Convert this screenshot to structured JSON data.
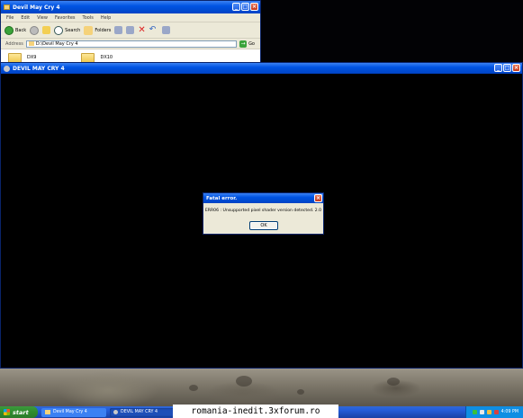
{
  "explorer": {
    "title": "Devil May Cry 4",
    "menu": [
      "File",
      "Edit",
      "View",
      "Favorites",
      "Tools",
      "Help"
    ],
    "toolbar": {
      "back": "Back",
      "search": "Search",
      "folders": "Folders"
    },
    "address_label": "Address",
    "address_value": "D:\\Devil May Cry 4",
    "go_label": "Go",
    "files": [
      {
        "name": "DX9",
        "icon": "folder-icon"
      },
      {
        "name": "DX10",
        "icon": "folder-icon"
      }
    ]
  },
  "game_window": {
    "title": "DEVIL MAY CRY 4"
  },
  "dialog": {
    "title": "Fatal error.",
    "message": "ERR06 : Unsupported pixel shader version detected. 2.0",
    "ok_label": "OK"
  },
  "taskbar": {
    "start_label": "start",
    "tasks": [
      {
        "label": "Devil May Cry 4",
        "icon": "folder-icon",
        "active": false
      },
      {
        "label": "DEVIL MAY CRY 4",
        "icon": "game-icon",
        "active": true
      }
    ],
    "clock": "4:09 PM",
    "watermark": "romania-inedit.3xforum.ro"
  },
  "colors": {
    "title_bar": "#0054e3",
    "window_face": "#ece9d8",
    "close_button": "#c5381c",
    "taskbar": "#245edb",
    "start_button": "#2e8b2e",
    "tray": "#0f8ee3"
  }
}
